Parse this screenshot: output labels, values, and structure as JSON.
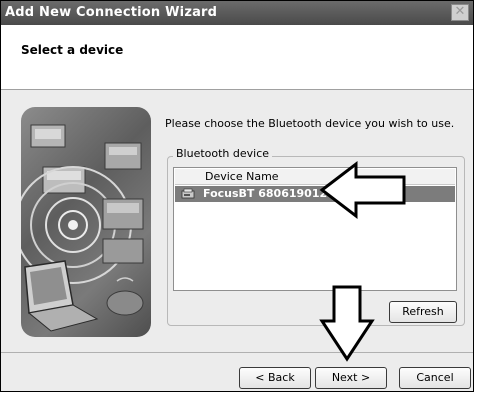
{
  "window": {
    "title": "Add New Connection Wizard",
    "close_glyph": "✕"
  },
  "header": {
    "heading": "Select a device"
  },
  "main": {
    "instruction": "Please choose the Bluetooth device you wish to use.",
    "group_label": "Bluetooth device",
    "list": {
      "column_header": "Device Name",
      "rows": [
        {
          "name": "FocusBT 6806190124",
          "icon": "bluetooth-device-icon",
          "selected": true
        }
      ]
    },
    "refresh_label": "Refresh"
  },
  "footer": {
    "back_label": "< Back",
    "next_label": "Next >",
    "cancel_label": "Cancel"
  },
  "colors": {
    "title_bar": "#555555",
    "selection": "#7c7c7c",
    "dialog": "#ececec"
  }
}
